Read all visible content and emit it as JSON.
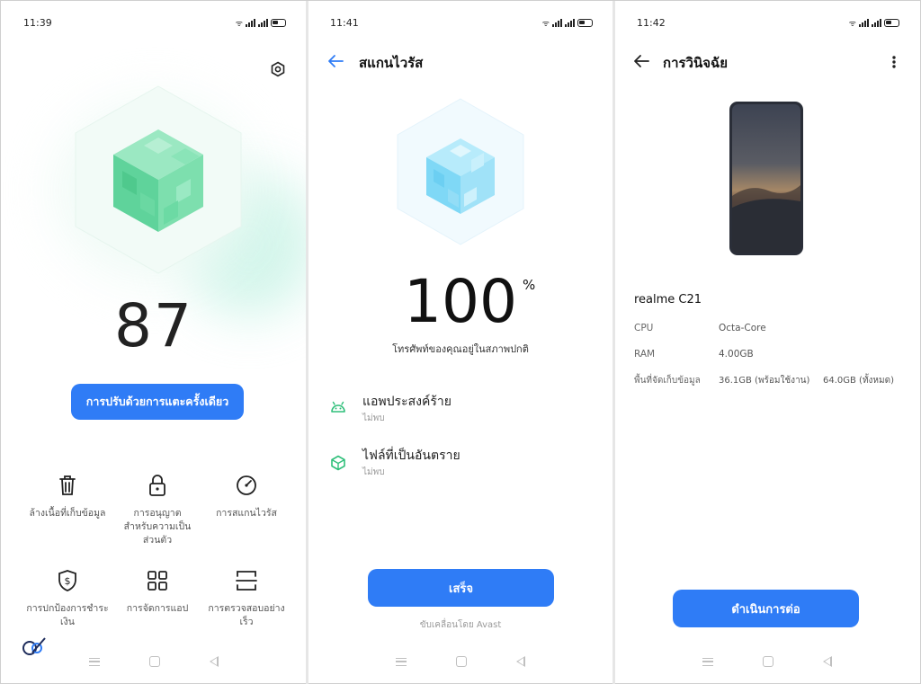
{
  "colors": {
    "accent": "#2f7cf6",
    "cube_green": "#5fd39b",
    "cube_blue": "#7fd8f6",
    "safe_green": "#2fbf7a"
  },
  "screen1": {
    "time": "11:39",
    "settings_icon": "gear-icon",
    "score": "87",
    "optimize_button": "การปรับด้วยการแตะครั้งเดียว",
    "grid": [
      {
        "icon": "trash-icon",
        "label": "ล้างเนื้อที่เก็บข้อมูล"
      },
      {
        "icon": "lock-icon",
        "label": "การอนุญาตสำหรับความเป็นส่วนตัว"
      },
      {
        "icon": "speedometer-icon",
        "label": "การสแกนไวรัส"
      },
      {
        "icon": "shield-dollar-icon",
        "label": "การปกป้องการชำระเงิน"
      },
      {
        "icon": "apps-grid-icon",
        "label": "การจัดการแอป"
      },
      {
        "icon": "quick-scan-icon",
        "label": "การตรวจสอบอย่างเร็ว"
      }
    ]
  },
  "screen2": {
    "time": "11:41",
    "title": "สแกนไวรัส",
    "percent": "100",
    "percent_sign": "%",
    "status": "โทรศัพท์ของคุณอยู่ในสภาพปกติ",
    "rows": [
      {
        "icon": "android-icon",
        "title": "แอพประสงค์ร้าย",
        "result": "ไม่พบ"
      },
      {
        "icon": "cube-file-icon",
        "title": "ไฟล์ที่เป็นอันตราย",
        "result": "ไม่พบ"
      }
    ],
    "done_button": "เสร็จ",
    "powered_by": "ขับเคลื่อนโดย Avast"
  },
  "screen3": {
    "time": "11:42",
    "title": "การวินิจฉัย",
    "device": "realme C21",
    "specs": [
      {
        "key": "CPU",
        "value": "Octa-Core",
        "value2": ""
      },
      {
        "key": "RAM",
        "value": "4.00GB",
        "value2": ""
      },
      {
        "key": "พื้นที่จัดเก็บข้อมูล",
        "value": "36.1GB (พร้อมใช้งาน)",
        "value2": "64.0GB (ทั้งหมด)"
      }
    ],
    "continue_button": "ดำเนินการต่อ"
  }
}
